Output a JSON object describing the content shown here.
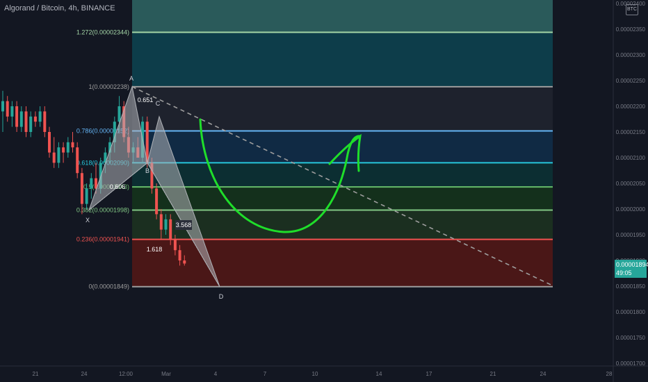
{
  "header": {
    "title": "Algorand / Bitcoin, 4h, BINANCE",
    "currency_badge": "BTC"
  },
  "price_tag": {
    "price": "0.00001894",
    "countdown": "49:05"
  },
  "chart_data": {
    "type": "candlestick",
    "y_axis": {
      "ticks": [
        "0.00002350",
        "0.00002300",
        "0.00002250",
        "0.00002200",
        "0.00002150",
        "0.00002100",
        "0.00002050",
        "0.00002000",
        "0.00001950",
        "0.00001900",
        "0.00001850",
        "0.00001800",
        "0.00001750",
        "0.00001700"
      ],
      "top_label": "0.00002400"
    },
    "x_axis": {
      "ticks": [
        "21",
        "24",
        "12:00",
        "Mar",
        "4",
        "7",
        "10",
        "14",
        "17",
        "21",
        "24",
        "28"
      ]
    },
    "fib_levels": [
      {
        "label": "1.272(0.00002344)",
        "value": 2.344e-05,
        "color": "#a5d6a7",
        "fill": "#0d3d4a"
      },
      {
        "label": "1(0.00002238)",
        "value": 2.238e-05,
        "color": "#9e9e9e",
        "fill": "#1e222d"
      },
      {
        "label": "0.786(0.00002152)",
        "value": 2.152e-05,
        "color": "#64b5f6",
        "fill": "#102a44"
      },
      {
        "label": "0.618(0.00002090)",
        "value": 2.09e-05,
        "color": "#26c6da",
        "fill": "#0c2e32"
      },
      {
        "label": "0.5(0.00002043)",
        "value": 2.043e-05,
        "color": "#66bb6a",
        "fill": "#14301c"
      },
      {
        "label": "0.382(0.00001998)",
        "value": 1.998e-05,
        "color": "#81c784",
        "fill": "#1b2f20"
      },
      {
        "label": "0.236(0.00001941)",
        "value": 1.941e-05,
        "color": "#ef5350",
        "fill": "#4a1717"
      },
      {
        "label": "0(0.00001849)",
        "value": 1.849e-05,
        "color": "#9e9e9e",
        "fill": null
      }
    ],
    "top_band_fill": "#2a5a5a",
    "pattern_points": [
      "X",
      "A",
      "B",
      "C",
      "D"
    ],
    "ratios": [
      "0.651",
      "0.606",
      "3.568",
      "1.618"
    ],
    "colors": {
      "up": "#26a69a",
      "down": "#ef5350",
      "arrow": "#1fde2a",
      "pattern": "#b0b3b8"
    },
    "candles": [
      {
        "o": 2.19e-05,
        "h": 2.23e-05,
        "l": 2.15e-05,
        "c": 2.21e-05
      },
      {
        "o": 2.21e-05,
        "h": 2.22e-05,
        "l": 2.17e-05,
        "c": 2.18e-05
      },
      {
        "o": 2.18e-05,
        "h": 2.21e-05,
        "l": 2.16e-05,
        "c": 2.2e-05
      },
      {
        "o": 2.2e-05,
        "h": 2.21e-05,
        "l": 2.15e-05,
        "c": 2.16e-05
      },
      {
        "o": 2.16e-05,
        "h": 2.2e-05,
        "l": 2.15e-05,
        "c": 2.19e-05
      },
      {
        "o": 2.19e-05,
        "h": 2.2e-05,
        "l": 2.14e-05,
        "c": 2.15e-05
      },
      {
        "o": 2.15e-05,
        "h": 2.19e-05,
        "l": 2.14e-05,
        "c": 2.18e-05
      },
      {
        "o": 2.18e-05,
        "h": 2.19e-05,
        "l": 2.16e-05,
        "c": 2.17e-05
      },
      {
        "o": 2.17e-05,
        "h": 2.2e-05,
        "l": 2.16e-05,
        "c": 2.19e-05
      },
      {
        "o": 2.19e-05,
        "h": 2.2e-05,
        "l": 2.14e-05,
        "c": 2.15e-05
      },
      {
        "o": 2.15e-05,
        "h": 2.16e-05,
        "l": 2.1e-05,
        "c": 2.11e-05
      },
      {
        "o": 2.11e-05,
        "h": 2.14e-05,
        "l": 2.08e-05,
        "c": 2.09e-05
      },
      {
        "o": 2.09e-05,
        "h": 2.13e-05,
        "l": 2.08e-05,
        "c": 2.12e-05
      },
      {
        "o": 2.12e-05,
        "h": 2.13e-05,
        "l": 2.09e-05,
        "c": 2.11e-05
      },
      {
        "o": 2.11e-05,
        "h": 2.14e-05,
        "l": 2.1e-05,
        "c": 2.13e-05
      },
      {
        "o": 2.13e-05,
        "h": 2.15e-05,
        "l": 2.11e-05,
        "c": 2.12e-05
      },
      {
        "o": 2.12e-05,
        "h": 2.13e-05,
        "l": 2.06e-05,
        "c": 2.07e-05
      },
      {
        "o": 2.07e-05,
        "h": 2.08e-05,
        "l": 1.99e-05,
        "c": 2.01e-05
      },
      {
        "o": 2.01e-05,
        "h": 2.05e-05,
        "l": 2e-05,
        "c": 2.04e-05
      },
      {
        "o": 2.04e-05,
        "h": 2.07e-05,
        "l": 2.02e-05,
        "c": 2.06e-05
      },
      {
        "o": 2.06e-05,
        "h": 2.09e-05,
        "l": 2.03e-05,
        "c": 2.04e-05
      },
      {
        "o": 2.04e-05,
        "h": 2.1e-05,
        "l": 2.03e-05,
        "c": 2.09e-05
      },
      {
        "o": 2.09e-05,
        "h": 2.12e-05,
        "l": 2.07e-05,
        "c": 2.11e-05
      },
      {
        "o": 2.11e-05,
        "h": 2.14e-05,
        "l": 2.09e-05,
        "c": 2.13e-05
      },
      {
        "o": 2.13e-05,
        "h": 2.18e-05,
        "l": 2.11e-05,
        "c": 2.17e-05
      },
      {
        "o": 2.17e-05,
        "h": 2.22e-05,
        "l": 2.15e-05,
        "c": 2.2e-05
      },
      {
        "o": 2.2e-05,
        "h": 2.21e-05,
        "l": 2.13e-05,
        "c": 2.14e-05
      },
      {
        "o": 2.14e-05,
        "h": 2.16e-05,
        "l": 2.1e-05,
        "c": 2.11e-05
      },
      {
        "o": 2.11e-05,
        "h": 2.13e-05,
        "l": 2.09e-05,
        "c": 2.12e-05
      },
      {
        "o": 2.12e-05,
        "h": 2.14e-05,
        "l": 2.1e-05,
        "c": 2.1e-05
      },
      {
        "o": 2.1e-05,
        "h": 2.18e-05,
        "l": 2.09e-05,
        "c": 2.17e-05
      },
      {
        "o": 2.17e-05,
        "h": 2.18e-05,
        "l": 2.08e-05,
        "c": 2.09e-05
      },
      {
        "o": 2.09e-05,
        "h": 2.1e-05,
        "l": 2.03e-05,
        "c": 2.04e-05
      },
      {
        "o": 2.04e-05,
        "h": 2.05e-05,
        "l": 1.98e-05,
        "c": 1.99e-05
      },
      {
        "o": 1.99e-05,
        "h": 2e-05,
        "l": 1.94e-05,
        "c": 1.96e-05
      },
      {
        "o": 1.96e-05,
        "h": 1.99e-05,
        "l": 1.95e-05,
        "c": 1.98e-05
      },
      {
        "o": 1.98e-05,
        "h": 1.99e-05,
        "l": 1.93e-05,
        "c": 1.94e-05
      },
      {
        "o": 1.94e-05,
        "h": 1.95e-05,
        "l": 1.91e-05,
        "c": 1.92e-05
      },
      {
        "o": 1.92e-05,
        "h": 1.93e-05,
        "l": 1.89e-05,
        "c": 1.9e-05
      },
      {
        "o": 1.9e-05,
        "h": 1.91e-05,
        "l": 1.89e-05,
        "c": 1.894e-05
      }
    ]
  }
}
